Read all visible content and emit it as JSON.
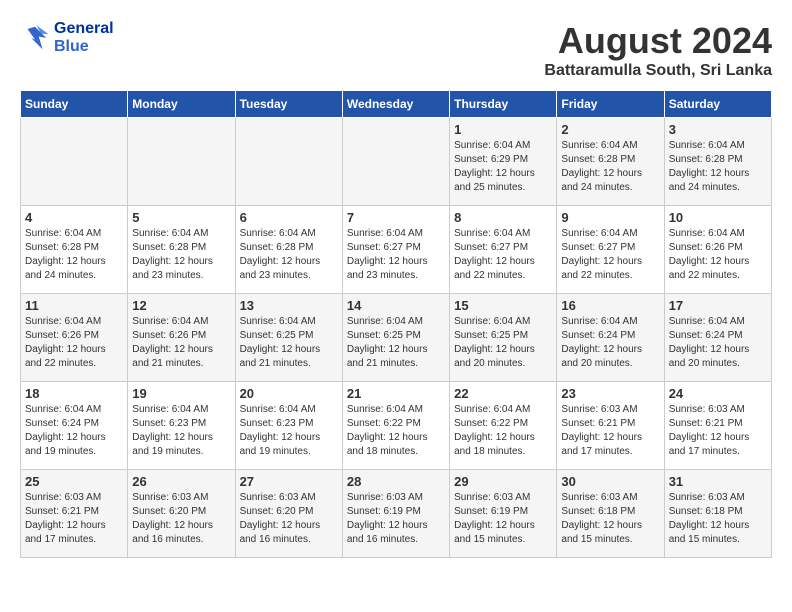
{
  "header": {
    "logo_line1": "General",
    "logo_line2": "Blue",
    "title": "August 2024",
    "subtitle": "Battaramulla South, Sri Lanka"
  },
  "weekdays": [
    "Sunday",
    "Monday",
    "Tuesday",
    "Wednesday",
    "Thursday",
    "Friday",
    "Saturday"
  ],
  "weeks": [
    [
      {
        "day": "",
        "sunrise": "",
        "sunset": "",
        "daylight": ""
      },
      {
        "day": "",
        "sunrise": "",
        "sunset": "",
        "daylight": ""
      },
      {
        "day": "",
        "sunrise": "",
        "sunset": "",
        "daylight": ""
      },
      {
        "day": "",
        "sunrise": "",
        "sunset": "",
        "daylight": ""
      },
      {
        "day": "1",
        "sunrise": "Sunrise: 6:04 AM",
        "sunset": "Sunset: 6:29 PM",
        "daylight": "Daylight: 12 hours and 25 minutes."
      },
      {
        "day": "2",
        "sunrise": "Sunrise: 6:04 AM",
        "sunset": "Sunset: 6:28 PM",
        "daylight": "Daylight: 12 hours and 24 minutes."
      },
      {
        "day": "3",
        "sunrise": "Sunrise: 6:04 AM",
        "sunset": "Sunset: 6:28 PM",
        "daylight": "Daylight: 12 hours and 24 minutes."
      }
    ],
    [
      {
        "day": "4",
        "sunrise": "Sunrise: 6:04 AM",
        "sunset": "Sunset: 6:28 PM",
        "daylight": "Daylight: 12 hours and 24 minutes."
      },
      {
        "day": "5",
        "sunrise": "Sunrise: 6:04 AM",
        "sunset": "Sunset: 6:28 PM",
        "daylight": "Daylight: 12 hours and 23 minutes."
      },
      {
        "day": "6",
        "sunrise": "Sunrise: 6:04 AM",
        "sunset": "Sunset: 6:28 PM",
        "daylight": "Daylight: 12 hours and 23 minutes."
      },
      {
        "day": "7",
        "sunrise": "Sunrise: 6:04 AM",
        "sunset": "Sunset: 6:27 PM",
        "daylight": "Daylight: 12 hours and 23 minutes."
      },
      {
        "day": "8",
        "sunrise": "Sunrise: 6:04 AM",
        "sunset": "Sunset: 6:27 PM",
        "daylight": "Daylight: 12 hours and 22 minutes."
      },
      {
        "day": "9",
        "sunrise": "Sunrise: 6:04 AM",
        "sunset": "Sunset: 6:27 PM",
        "daylight": "Daylight: 12 hours and 22 minutes."
      },
      {
        "day": "10",
        "sunrise": "Sunrise: 6:04 AM",
        "sunset": "Sunset: 6:26 PM",
        "daylight": "Daylight: 12 hours and 22 minutes."
      }
    ],
    [
      {
        "day": "11",
        "sunrise": "Sunrise: 6:04 AM",
        "sunset": "Sunset: 6:26 PM",
        "daylight": "Daylight: 12 hours and 22 minutes."
      },
      {
        "day": "12",
        "sunrise": "Sunrise: 6:04 AM",
        "sunset": "Sunset: 6:26 PM",
        "daylight": "Daylight: 12 hours and 21 minutes."
      },
      {
        "day": "13",
        "sunrise": "Sunrise: 6:04 AM",
        "sunset": "Sunset: 6:25 PM",
        "daylight": "Daylight: 12 hours and 21 minutes."
      },
      {
        "day": "14",
        "sunrise": "Sunrise: 6:04 AM",
        "sunset": "Sunset: 6:25 PM",
        "daylight": "Daylight: 12 hours and 21 minutes."
      },
      {
        "day": "15",
        "sunrise": "Sunrise: 6:04 AM",
        "sunset": "Sunset: 6:25 PM",
        "daylight": "Daylight: 12 hours and 20 minutes."
      },
      {
        "day": "16",
        "sunrise": "Sunrise: 6:04 AM",
        "sunset": "Sunset: 6:24 PM",
        "daylight": "Daylight: 12 hours and 20 minutes."
      },
      {
        "day": "17",
        "sunrise": "Sunrise: 6:04 AM",
        "sunset": "Sunset: 6:24 PM",
        "daylight": "Daylight: 12 hours and 20 minutes."
      }
    ],
    [
      {
        "day": "18",
        "sunrise": "Sunrise: 6:04 AM",
        "sunset": "Sunset: 6:24 PM",
        "daylight": "Daylight: 12 hours and 19 minutes."
      },
      {
        "day": "19",
        "sunrise": "Sunrise: 6:04 AM",
        "sunset": "Sunset: 6:23 PM",
        "daylight": "Daylight: 12 hours and 19 minutes."
      },
      {
        "day": "20",
        "sunrise": "Sunrise: 6:04 AM",
        "sunset": "Sunset: 6:23 PM",
        "daylight": "Daylight: 12 hours and 19 minutes."
      },
      {
        "day": "21",
        "sunrise": "Sunrise: 6:04 AM",
        "sunset": "Sunset: 6:22 PM",
        "daylight": "Daylight: 12 hours and 18 minutes."
      },
      {
        "day": "22",
        "sunrise": "Sunrise: 6:04 AM",
        "sunset": "Sunset: 6:22 PM",
        "daylight": "Daylight: 12 hours and 18 minutes."
      },
      {
        "day": "23",
        "sunrise": "Sunrise: 6:03 AM",
        "sunset": "Sunset: 6:21 PM",
        "daylight": "Daylight: 12 hours and 17 minutes."
      },
      {
        "day": "24",
        "sunrise": "Sunrise: 6:03 AM",
        "sunset": "Sunset: 6:21 PM",
        "daylight": "Daylight: 12 hours and 17 minutes."
      }
    ],
    [
      {
        "day": "25",
        "sunrise": "Sunrise: 6:03 AM",
        "sunset": "Sunset: 6:21 PM",
        "daylight": "Daylight: 12 hours and 17 minutes."
      },
      {
        "day": "26",
        "sunrise": "Sunrise: 6:03 AM",
        "sunset": "Sunset: 6:20 PM",
        "daylight": "Daylight: 12 hours and 16 minutes."
      },
      {
        "day": "27",
        "sunrise": "Sunrise: 6:03 AM",
        "sunset": "Sunset: 6:20 PM",
        "daylight": "Daylight: 12 hours and 16 minutes."
      },
      {
        "day": "28",
        "sunrise": "Sunrise: 6:03 AM",
        "sunset": "Sunset: 6:19 PM",
        "daylight": "Daylight: 12 hours and 16 minutes."
      },
      {
        "day": "29",
        "sunrise": "Sunrise: 6:03 AM",
        "sunset": "Sunset: 6:19 PM",
        "daylight": "Daylight: 12 hours and 15 minutes."
      },
      {
        "day": "30",
        "sunrise": "Sunrise: 6:03 AM",
        "sunset": "Sunset: 6:18 PM",
        "daylight": "Daylight: 12 hours and 15 minutes."
      },
      {
        "day": "31",
        "sunrise": "Sunrise: 6:03 AM",
        "sunset": "Sunset: 6:18 PM",
        "daylight": "Daylight: 12 hours and 15 minutes."
      }
    ]
  ]
}
